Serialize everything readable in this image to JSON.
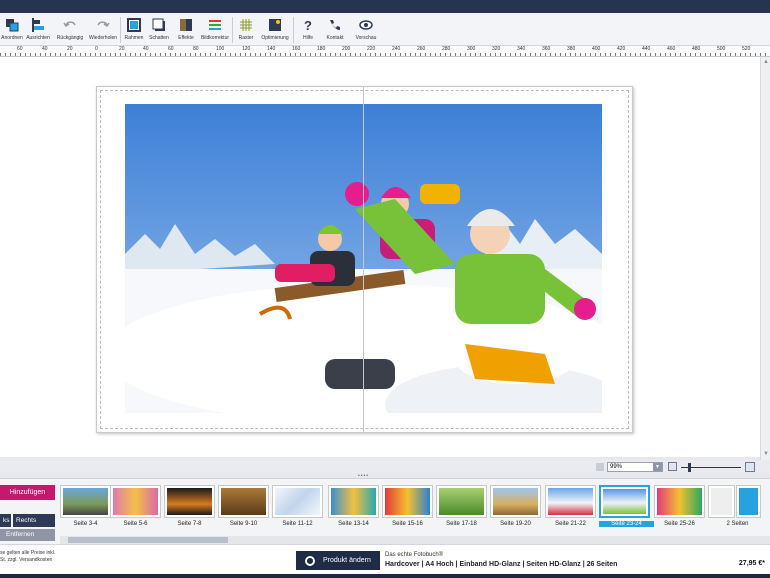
{
  "toolbar": {
    "buttons": [
      {
        "label": "Anordnen",
        "icon": "arrange-icon"
      },
      {
        "label": "Ausrichten",
        "icon": "align-icon"
      },
      {
        "label": "Rückgängig",
        "icon": "undo-icon"
      },
      {
        "label": "Wiederholen",
        "icon": "redo-icon"
      },
      {
        "label": "Rahmen",
        "icon": "frame-icon"
      },
      {
        "label": "Schatten",
        "icon": "shadow-icon"
      },
      {
        "label": "Effekte",
        "icon": "effects-icon"
      },
      {
        "label": "Bildkorrektur",
        "icon": "image-correction-icon"
      },
      {
        "label": "Raster",
        "icon": "grid-icon"
      },
      {
        "label": "Optimierung",
        "icon": "optimize-icon"
      },
      {
        "label": "Hilfe",
        "icon": "help-icon"
      },
      {
        "label": "Kontakt",
        "icon": "phone-icon"
      },
      {
        "label": "Vorschau",
        "icon": "eye-icon"
      }
    ]
  },
  "ruler": {
    "ticks": [
      "60",
      "40",
      "20",
      "0",
      "20",
      "40",
      "60",
      "80",
      "100",
      "120",
      "140",
      "160",
      "180",
      "200",
      "220",
      "240",
      "260",
      "280",
      "300",
      "320",
      "340",
      "360",
      "380",
      "400",
      "420",
      "440",
      "460",
      "480",
      "500",
      "520"
    ]
  },
  "zoom": {
    "value": "99%"
  },
  "pages": {
    "add_label": "Hinzufügen",
    "left_label": "ks",
    "right_label": "Rechts",
    "remove_label": "Entfernen",
    "thumbs": [
      {
        "label": "Seite 3-4",
        "selected": false
      },
      {
        "label": "Seite 5-6",
        "selected": false
      },
      {
        "label": "Seite 7-8",
        "selected": false
      },
      {
        "label": "Seite 9-10",
        "selected": false
      },
      {
        "label": "Seite 11-12",
        "selected": false
      },
      {
        "label": "Seite 13-14",
        "selected": false
      },
      {
        "label": "Seite 15-16",
        "selected": false
      },
      {
        "label": "Seite 17-18",
        "selected": false
      },
      {
        "label": "Seite 19-20",
        "selected": false
      },
      {
        "label": "Seite 21-22",
        "selected": false
      },
      {
        "label": "Seite 23-24",
        "selected": true
      },
      {
        "label": "Seite 25-26",
        "selected": false
      },
      {
        "label": "2 Seiten",
        "selected": false
      }
    ]
  },
  "footer": {
    "price_note_1": "se gelten alle Preise inkl.",
    "price_note_2": "St. zzgl. Versandkosten",
    "change_product": "Produkt ändern",
    "product_title": "Das echte Fotobuch®",
    "product_desc": "Hardcover | A4 Hoch | Einband HD-Glanz | Seiten HD-Glanz | 26 Seiten",
    "price": "27,95 €*"
  },
  "colors": {
    "accent": "#c5196e",
    "dark": "#263450",
    "selection": "#27a2df"
  }
}
